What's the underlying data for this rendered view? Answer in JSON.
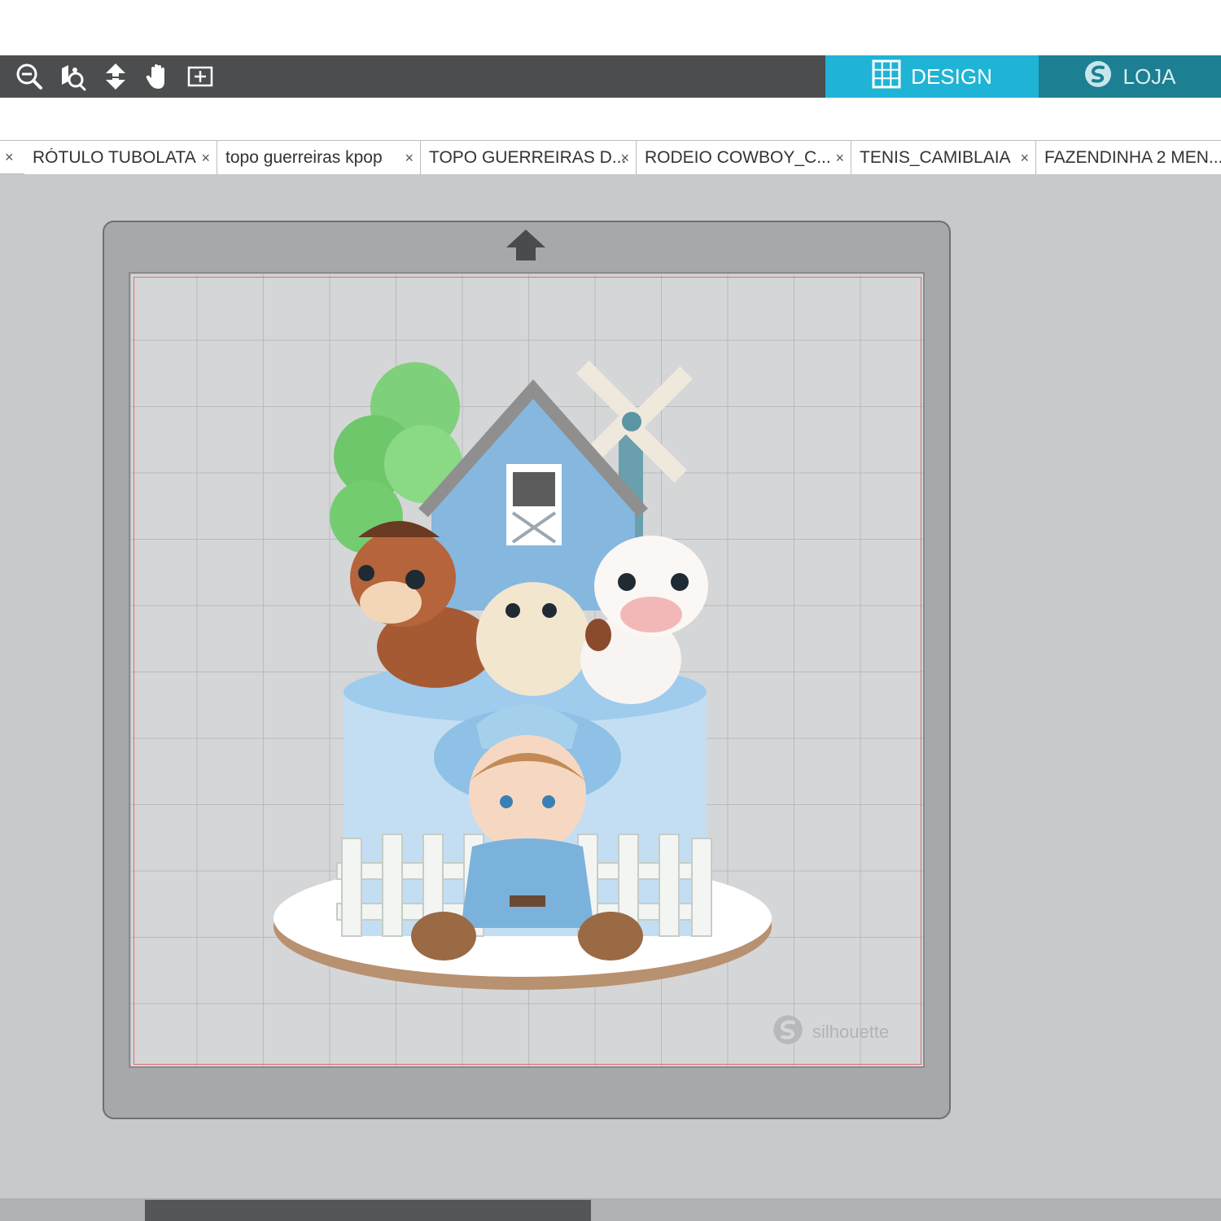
{
  "toolbar": {
    "icons": [
      "zoom-out-icon",
      "zoom-selection-icon",
      "fit-to-page-icon",
      "pan-hand-icon",
      "zoom-fit-icon"
    ]
  },
  "nav_tabs": {
    "design_label": "DESIGN",
    "store_label": "LOJA"
  },
  "document_tabs": [
    {
      "label": "RÓTULO TUBOLATA"
    },
    {
      "label": "topo guerreiras kpop"
    },
    {
      "label": "TOPO GUERREIRAS D..."
    },
    {
      "label": "RODEIO COWBOY_C..."
    },
    {
      "label": "TENIS_CAMIBLAIA"
    },
    {
      "label": "FAZENDINHA 2 MEN..."
    }
  ],
  "close_glyph": "×",
  "watermark": {
    "text": "silhouette"
  },
  "colors": {
    "toolbar_bg": "#4b4d4f",
    "design_tab": "#1fb4d6",
    "store_tab": "#1c7f92",
    "cut_border": "#e06b6b"
  }
}
